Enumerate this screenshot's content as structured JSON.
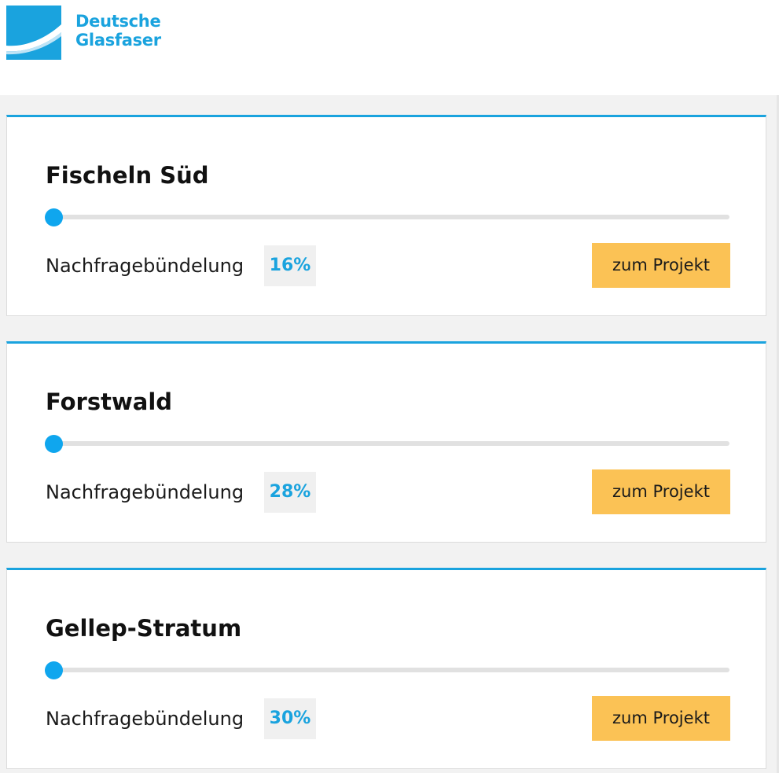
{
  "brand": {
    "line1": "Deutsche",
    "line2": "Glasfaser",
    "colors": {
      "blue": "#1aa3de",
      "accent_yellow": "#fbc255"
    }
  },
  "projects": [
    {
      "name": "Fischeln Süd",
      "label": "Nachfragebündelung",
      "percent_text": "16%",
      "progress": 0.16,
      "button_label": "zum Projekt"
    },
    {
      "name": "Forstwald",
      "label": "Nachfragebündelung",
      "percent_text": "28%",
      "progress": 0.28,
      "button_label": "zum Projekt"
    },
    {
      "name": "Gellep-Stratum",
      "label": "Nachfragebündelung",
      "percent_text": "30%",
      "progress": 0.3,
      "button_label": "zum Projekt"
    }
  ]
}
